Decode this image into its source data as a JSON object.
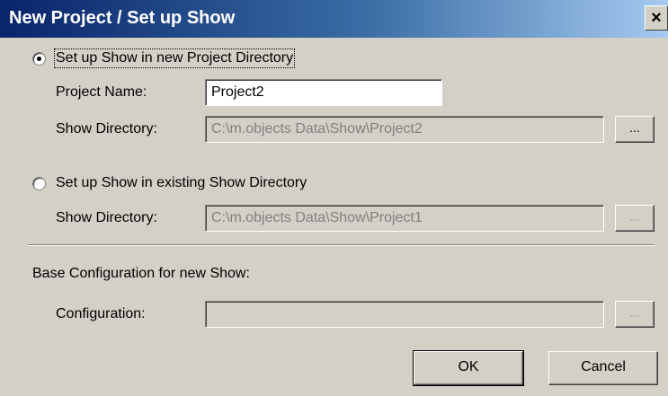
{
  "dialog": {
    "title": "New Project / Set up Show",
    "close_symbol": "×"
  },
  "option_new": {
    "label": "Set up Show in new Project Directory",
    "selected": true,
    "project_name_label": "Project Name:",
    "project_name_value": "Project2",
    "show_directory_label": "Show Directory:",
    "show_directory_value": "C:\\m.objects Data\\Show\\Project2",
    "browse_label": "..."
  },
  "option_existing": {
    "label": "Set up Show in existing Show Directory",
    "selected": false,
    "show_directory_label": "Show Directory:",
    "show_directory_value": "C:\\m.objects Data\\Show\\Project1",
    "browse_label": "..."
  },
  "base_config": {
    "heading": "Base Configuration for new Show:",
    "configuration_label": "Configuration:",
    "configuration_value": "",
    "browse_label": "..."
  },
  "buttons": {
    "ok": "OK",
    "cancel": "Cancel"
  }
}
